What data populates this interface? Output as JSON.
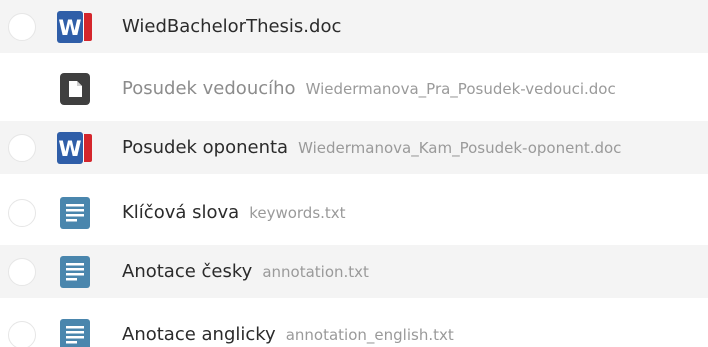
{
  "files": [
    {
      "name": "WiedBachelorThesis.doc",
      "filename": "",
      "icon": "word-doc-icon"
    },
    {
      "name": "Posudek vedoucího",
      "filename": "Wiedermanova_Pra_Posudek-vedouci.doc",
      "icon": "generic-file-icon"
    },
    {
      "name": "Posudek oponenta",
      "filename": "Wiedermanova_Kam_Posudek-oponent.doc",
      "icon": "word-doc-icon"
    },
    {
      "name": "Klíčová slova",
      "filename": "keywords.txt",
      "icon": "text-file-icon"
    },
    {
      "name": "Anotace česky",
      "filename": "annotation.txt",
      "icon": "text-file-icon"
    },
    {
      "name": "Anotace anglicky",
      "filename": "annotation_english.txt",
      "icon": "text-file-icon"
    }
  ],
  "colors": {
    "row_alt_bg": "#f4f4f4",
    "word_blue": "#2f5ea8",
    "word_red": "#d4262c",
    "text_icon_blue": "#4a86ad",
    "generic_icon_dark": "#3f3f3f"
  }
}
